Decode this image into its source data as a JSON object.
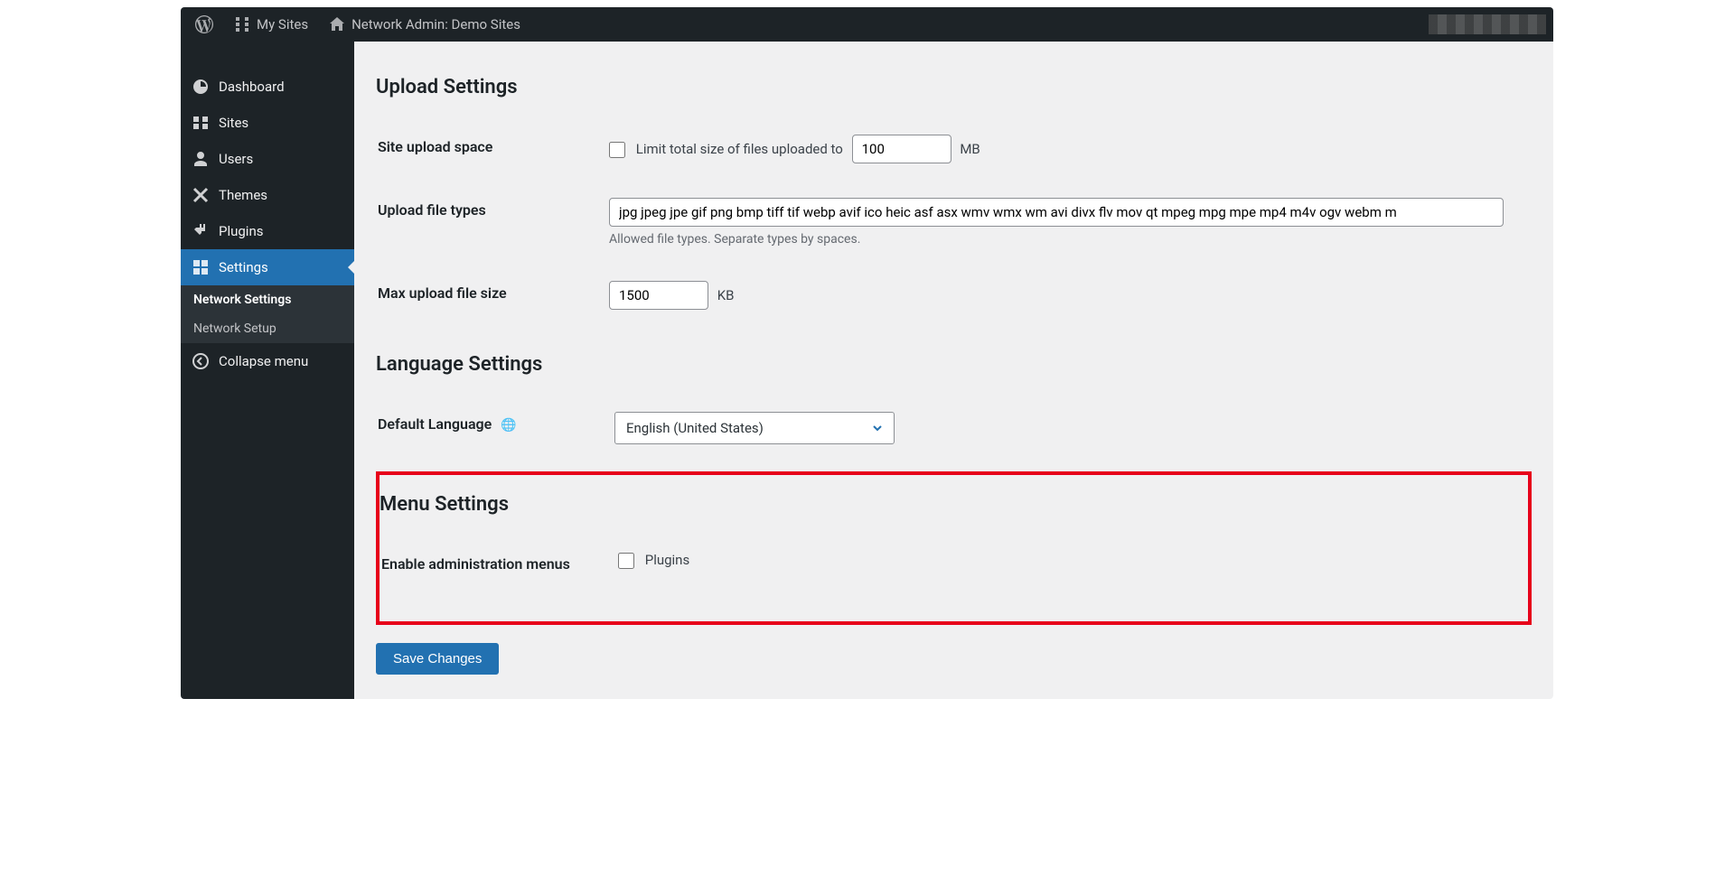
{
  "adminbar": {
    "my_sites": "My Sites",
    "network_admin": "Network Admin: Demo Sites"
  },
  "sidebar": {
    "items": [
      {
        "label": "Dashboard"
      },
      {
        "label": "Sites"
      },
      {
        "label": "Users"
      },
      {
        "label": "Themes"
      },
      {
        "label": "Plugins"
      },
      {
        "label": "Settings"
      }
    ],
    "submenu": [
      {
        "label": "Network Settings"
      },
      {
        "label": "Network Setup"
      }
    ],
    "collapse": "Collapse menu"
  },
  "sections": {
    "upload_title": "Upload Settings",
    "language_title": "Language Settings",
    "menu_title": "Menu Settings"
  },
  "fields": {
    "site_upload_space": {
      "label": "Site upload space",
      "checkbox_label": "Limit total size of files uploaded to",
      "value": "100",
      "unit": "MB"
    },
    "upload_file_types": {
      "label": "Upload file types",
      "value": "jpg jpeg jpe gif png bmp tiff tif webp avif ico heic asf asx wmv wmx wm avi divx flv mov qt mpeg mpg mpe mp4 m4v ogv webm m",
      "description": "Allowed file types. Separate types by spaces."
    },
    "max_upload_size": {
      "label": "Max upload file size",
      "value": "1500",
      "unit": "KB"
    },
    "default_language": {
      "label": "Default Language",
      "selected": "English (United States)"
    },
    "enable_admin_menus": {
      "label": "Enable administration menus",
      "checkbox_label": "Plugins"
    }
  },
  "buttons": {
    "save": "Save Changes"
  }
}
